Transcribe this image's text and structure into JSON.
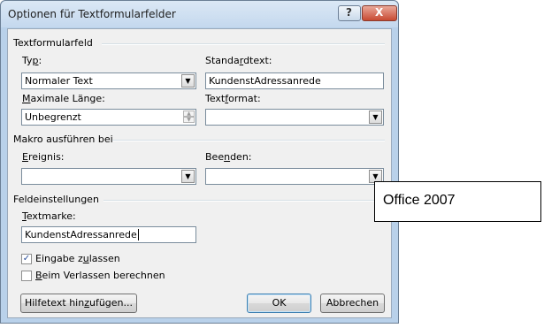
{
  "window": {
    "title": "Optionen für Textformularfelder",
    "help_glyph": "?",
    "close_glyph": "X"
  },
  "section_textformfield": {
    "heading": "Textformularfeld",
    "type_label_pre": "Ty",
    "type_label_u": "p",
    "type_label_post": ":",
    "type_value": "Normaler Text",
    "default_label_pre": "Standa",
    "default_label_u": "r",
    "default_label_post": "dtext:",
    "default_value": "KundenstAdressanrede",
    "maxlen_label_u": "M",
    "maxlen_label_post": "aximale Länge:",
    "maxlen_value": "Unbegrenzt",
    "format_label_pre": "Text",
    "format_label_u": "f",
    "format_label_post": "ormat:",
    "format_value": ""
  },
  "section_macro": {
    "heading": "Makro ausführen bei",
    "entry_label_u": "E",
    "entry_label_post": "reignis:",
    "entry_value": "",
    "exit_label_pre": "Bee",
    "exit_label_u": "n",
    "exit_label_post": "den:",
    "exit_value": ""
  },
  "section_field": {
    "heading": "Feldeinstellungen",
    "bookmark_label_u": "T",
    "bookmark_label_post": "extmarke:",
    "bookmark_value": "KundenstAdressanrede",
    "fill_in_label_pre": "Eingabe z",
    "fill_in_label_u": "u",
    "fill_in_label_post": "lassen",
    "fill_in_checked": true,
    "calc_label_u": "B",
    "calc_label_post": "eim Verlassen berechnen",
    "calc_checked": false
  },
  "buttons": {
    "help_text_pre": "Hilfetext hin",
    "help_text_u": "z",
    "help_text_post": "ufügen...",
    "ok": "OK",
    "cancel": "Abbrechen"
  },
  "overlay_label": "Office 2007",
  "icons": {
    "dropdown": "▼",
    "spin_up": "▲",
    "spin_down": "▼",
    "check": "✓"
  }
}
